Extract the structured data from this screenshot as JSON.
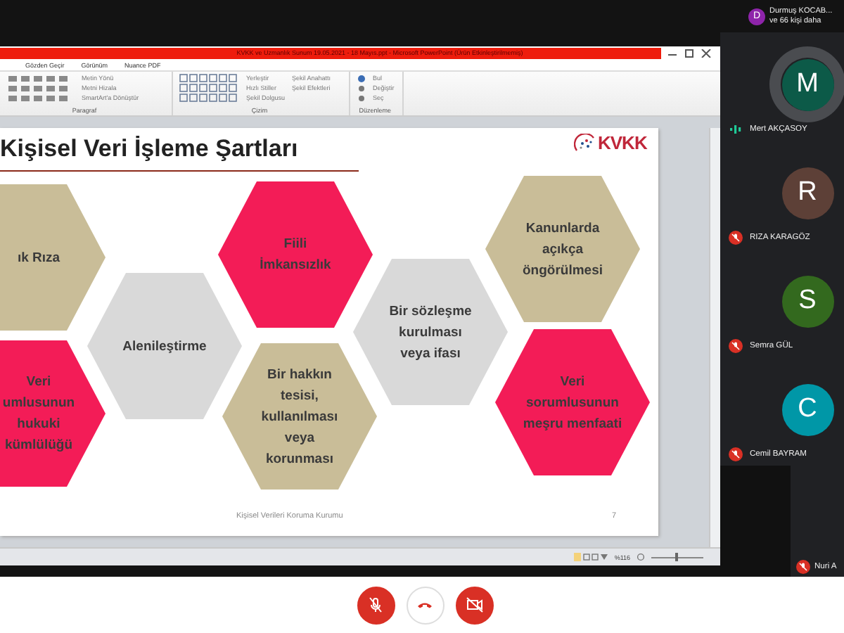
{
  "ppt": {
    "title": "KVKK ve Uzmanlık Sunum 19.05.2021 - 18 Mayıs.ppt - Microsoft PowerPoint (Ürün Etkinleştirilmemiş)",
    "tabs": [
      "Gözden Geçir",
      "Görünüm",
      "Nuance PDF"
    ],
    "ribbon_groups": [
      {
        "label": "Paragraf",
        "buttons": [
          "Metin Yönü",
          "Metni Hizala",
          "SmartArt'a Dönüştür"
        ]
      },
      {
        "label": "Çizim",
        "buttons": [
          "Yerleştir",
          "Hızlı Stiller",
          "Şekil Dolgusu",
          "Şekil Anahattı",
          "Şekil Efektleri"
        ]
      },
      {
        "label": "Düzenleme",
        "buttons": [
          "Bul",
          "Değiştir",
          "Seç"
        ]
      }
    ],
    "zoom": "%116",
    "zoom_slider": {
      "level": 0.45
    }
  },
  "slide": {
    "title": "Kişisel Veri İşleme Şartları",
    "logo": "KVKK",
    "hexagons": [
      {
        "lines": [
          "ık Rıza"
        ],
        "color": "#c9bd98"
      },
      {
        "lines": [
          "Veri",
          "umlusunun",
          "hukuki",
          "kümlülüğü"
        ],
        "color": "#f31c57"
      },
      {
        "lines": [
          "Alenileştirme"
        ],
        "color": "#d9d9d9"
      },
      {
        "lines": [
          "Fiili",
          "İmkansızlık"
        ],
        "color": "#f31c57"
      },
      {
        "lines": [
          "Bir hakkın",
          "tesisi,",
          "kullanılması",
          "veya",
          "korunması"
        ],
        "color": "#c9bd98"
      },
      {
        "lines": [
          "Bir sözleşme",
          "kurulması",
          "veya ifası"
        ],
        "color": "#d9d9d9"
      },
      {
        "lines": [
          "Kanunlarda",
          "açıkça",
          "öngörülmesi"
        ],
        "color": "#c9bd98"
      },
      {
        "lines": [
          "Veri",
          "sorumlusunun",
          "meşru menfaati"
        ],
        "color": "#f31c57"
      }
    ],
    "footer": "Kişisel Verileri Koruma Kurumu",
    "page": "7"
  },
  "participants_summary": {
    "initial": "D",
    "color": "#8e24aa",
    "name": "Durmuş KOCAB...",
    "more": "ve 66 kişi daha"
  },
  "participants": [
    {
      "kind": "avatar",
      "name": "Mert AKÇASOY",
      "initial": "M",
      "color": "#0c5a48",
      "muted": false
    },
    {
      "kind": "avatar",
      "name": "RIZA KARAGÖZ",
      "initial": "R",
      "color": "#5d4037",
      "muted": true
    },
    {
      "kind": "avatar",
      "name": "Semra GÜL",
      "initial": "S",
      "color": "#33691e",
      "muted": true
    },
    {
      "kind": "avatar",
      "name": "Cemil BAYRAM",
      "initial": "C",
      "color": "#0097a7",
      "muted": true
    },
    {
      "kind": "video",
      "name": "Nuri A",
      "muted": true
    }
  ],
  "controls": [
    {
      "kind": "mic",
      "on": false
    },
    {
      "kind": "hangup"
    },
    {
      "kind": "camera",
      "on": false
    }
  ]
}
